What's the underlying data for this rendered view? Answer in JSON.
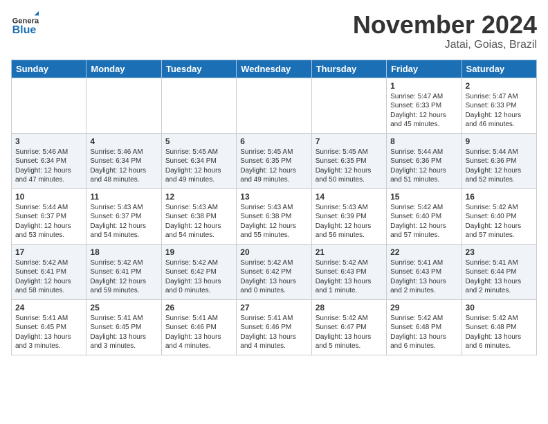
{
  "header": {
    "logo_general": "General",
    "logo_blue": "Blue",
    "month_title": "November 2024",
    "location": "Jatai, Goias, Brazil"
  },
  "days_of_week": [
    "Sunday",
    "Monday",
    "Tuesday",
    "Wednesday",
    "Thursday",
    "Friday",
    "Saturday"
  ],
  "weeks": [
    [
      {
        "day": "",
        "info": ""
      },
      {
        "day": "",
        "info": ""
      },
      {
        "day": "",
        "info": ""
      },
      {
        "day": "",
        "info": ""
      },
      {
        "day": "",
        "info": ""
      },
      {
        "day": "1",
        "info": "Sunrise: 5:47 AM\nSunset: 6:33 PM\nDaylight: 12 hours\nand 45 minutes."
      },
      {
        "day": "2",
        "info": "Sunrise: 5:47 AM\nSunset: 6:33 PM\nDaylight: 12 hours\nand 46 minutes."
      }
    ],
    [
      {
        "day": "3",
        "info": "Sunrise: 5:46 AM\nSunset: 6:34 PM\nDaylight: 12 hours\nand 47 minutes."
      },
      {
        "day": "4",
        "info": "Sunrise: 5:46 AM\nSunset: 6:34 PM\nDaylight: 12 hours\nand 48 minutes."
      },
      {
        "day": "5",
        "info": "Sunrise: 5:45 AM\nSunset: 6:34 PM\nDaylight: 12 hours\nand 49 minutes."
      },
      {
        "day": "6",
        "info": "Sunrise: 5:45 AM\nSunset: 6:35 PM\nDaylight: 12 hours\nand 49 minutes."
      },
      {
        "day": "7",
        "info": "Sunrise: 5:45 AM\nSunset: 6:35 PM\nDaylight: 12 hours\nand 50 minutes."
      },
      {
        "day": "8",
        "info": "Sunrise: 5:44 AM\nSunset: 6:36 PM\nDaylight: 12 hours\nand 51 minutes."
      },
      {
        "day": "9",
        "info": "Sunrise: 5:44 AM\nSunset: 6:36 PM\nDaylight: 12 hours\nand 52 minutes."
      }
    ],
    [
      {
        "day": "10",
        "info": "Sunrise: 5:44 AM\nSunset: 6:37 PM\nDaylight: 12 hours\nand 53 minutes."
      },
      {
        "day": "11",
        "info": "Sunrise: 5:43 AM\nSunset: 6:37 PM\nDaylight: 12 hours\nand 54 minutes."
      },
      {
        "day": "12",
        "info": "Sunrise: 5:43 AM\nSunset: 6:38 PM\nDaylight: 12 hours\nand 54 minutes."
      },
      {
        "day": "13",
        "info": "Sunrise: 5:43 AM\nSunset: 6:38 PM\nDaylight: 12 hours\nand 55 minutes."
      },
      {
        "day": "14",
        "info": "Sunrise: 5:43 AM\nSunset: 6:39 PM\nDaylight: 12 hours\nand 56 minutes."
      },
      {
        "day": "15",
        "info": "Sunrise: 5:42 AM\nSunset: 6:40 PM\nDaylight: 12 hours\nand 57 minutes."
      },
      {
        "day": "16",
        "info": "Sunrise: 5:42 AM\nSunset: 6:40 PM\nDaylight: 12 hours\nand 57 minutes."
      }
    ],
    [
      {
        "day": "17",
        "info": "Sunrise: 5:42 AM\nSunset: 6:41 PM\nDaylight: 12 hours\nand 58 minutes."
      },
      {
        "day": "18",
        "info": "Sunrise: 5:42 AM\nSunset: 6:41 PM\nDaylight: 12 hours\nand 59 minutes."
      },
      {
        "day": "19",
        "info": "Sunrise: 5:42 AM\nSunset: 6:42 PM\nDaylight: 13 hours\nand 0 minutes."
      },
      {
        "day": "20",
        "info": "Sunrise: 5:42 AM\nSunset: 6:42 PM\nDaylight: 13 hours\nand 0 minutes."
      },
      {
        "day": "21",
        "info": "Sunrise: 5:42 AM\nSunset: 6:43 PM\nDaylight: 13 hours\nand 1 minute."
      },
      {
        "day": "22",
        "info": "Sunrise: 5:41 AM\nSunset: 6:43 PM\nDaylight: 13 hours\nand 2 minutes."
      },
      {
        "day": "23",
        "info": "Sunrise: 5:41 AM\nSunset: 6:44 PM\nDaylight: 13 hours\nand 2 minutes."
      }
    ],
    [
      {
        "day": "24",
        "info": "Sunrise: 5:41 AM\nSunset: 6:45 PM\nDaylight: 13 hours\nand 3 minutes."
      },
      {
        "day": "25",
        "info": "Sunrise: 5:41 AM\nSunset: 6:45 PM\nDaylight: 13 hours\nand 3 minutes."
      },
      {
        "day": "26",
        "info": "Sunrise: 5:41 AM\nSunset: 6:46 PM\nDaylight: 13 hours\nand 4 minutes."
      },
      {
        "day": "27",
        "info": "Sunrise: 5:41 AM\nSunset: 6:46 PM\nDaylight: 13 hours\nand 4 minutes."
      },
      {
        "day": "28",
        "info": "Sunrise: 5:42 AM\nSunset: 6:47 PM\nDaylight: 13 hours\nand 5 minutes."
      },
      {
        "day": "29",
        "info": "Sunrise: 5:42 AM\nSunset: 6:48 PM\nDaylight: 13 hours\nand 6 minutes."
      },
      {
        "day": "30",
        "info": "Sunrise: 5:42 AM\nSunset: 6:48 PM\nDaylight: 13 hours\nand 6 minutes."
      }
    ]
  ]
}
